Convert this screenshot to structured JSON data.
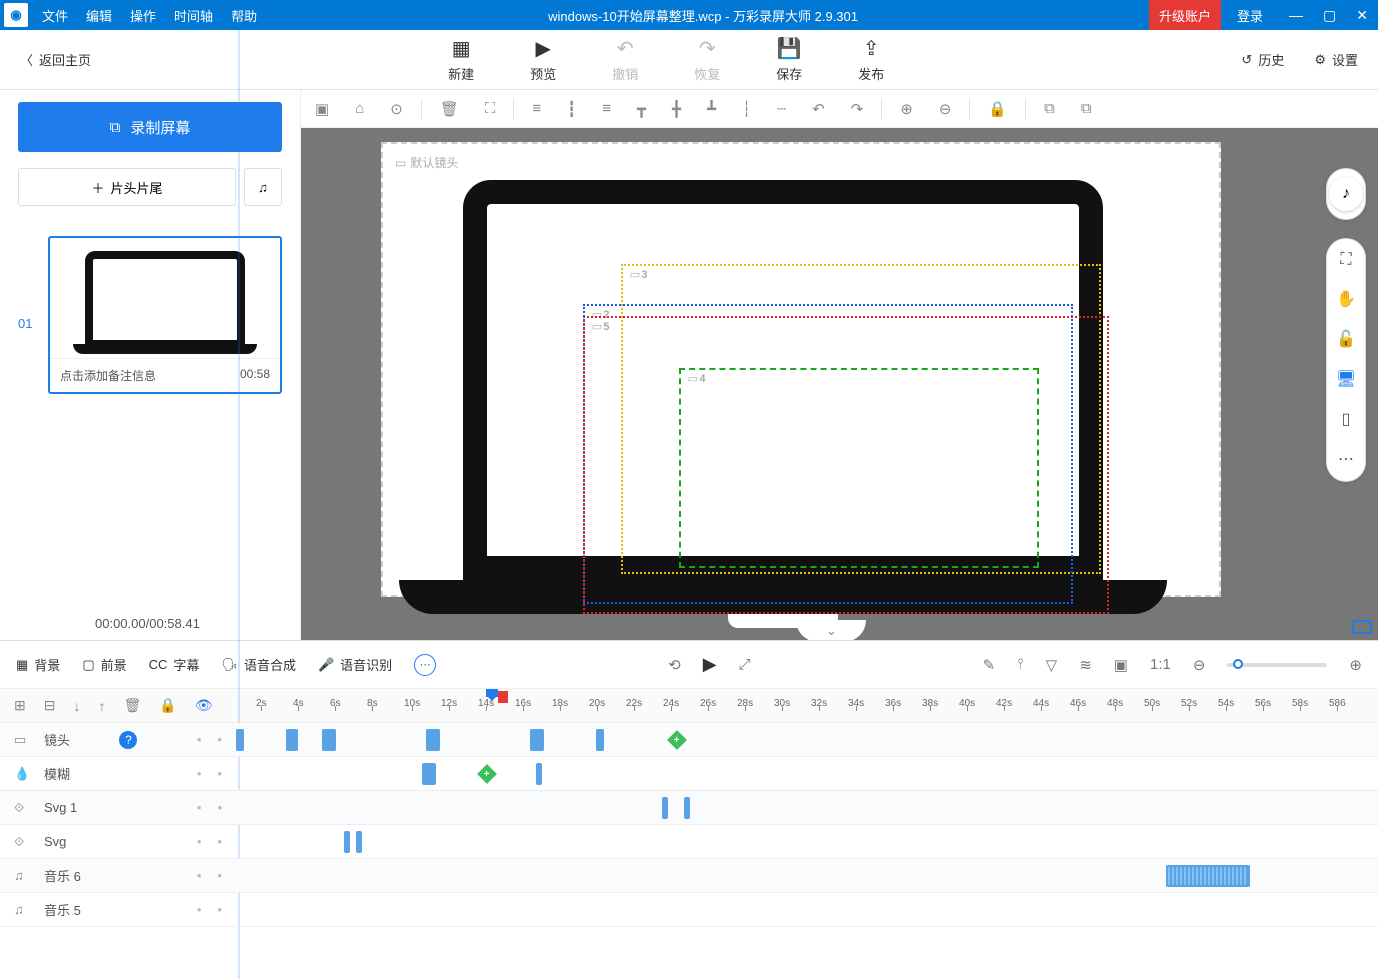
{
  "titlebar": {
    "menus": [
      "文件",
      "编辑",
      "操作",
      "时间轴",
      "帮助"
    ],
    "title": "windows-10开始屏幕整理.wcp - 万彩录屏大师 2.9.301",
    "upgrade": "升级账户",
    "login": "登录"
  },
  "toolbar": {
    "back": "返回主页",
    "new": "新建",
    "preview": "预览",
    "undo": "撤销",
    "redo": "恢复",
    "save": "保存",
    "publish": "发布",
    "history": "历史",
    "settings": "设置"
  },
  "sidebar": {
    "record": "录制屏幕",
    "headTail": "片头片尾",
    "sceneNum": "01",
    "sceneNote": "点击添加备注信息",
    "sceneDuration": "00:58",
    "timecode": "00:00.00/00:58.41"
  },
  "canvas": {
    "defaultCam": "默认镜头",
    "overlays": {
      "yellow": "3",
      "blue": "2",
      "red": "5",
      "green": "4"
    }
  },
  "timelineTop": {
    "bg": "背景",
    "fg": "前景",
    "subtitle": "字幕",
    "tts": "语音合成",
    "asr": "语音识别"
  },
  "ruler": {
    "start": 2,
    "end": 58,
    "step": 2,
    "suffix": "s",
    "last": "586"
  },
  "tracks": [
    {
      "icon": "camera",
      "label": "镜头",
      "help": true
    },
    {
      "icon": "drop",
      "label": "模糊"
    },
    {
      "icon": "svg",
      "label": "Svg 1"
    },
    {
      "icon": "svg",
      "label": "Svg"
    },
    {
      "icon": "music",
      "label": "音乐 6"
    },
    {
      "icon": "music",
      "label": "音乐 5"
    }
  ]
}
